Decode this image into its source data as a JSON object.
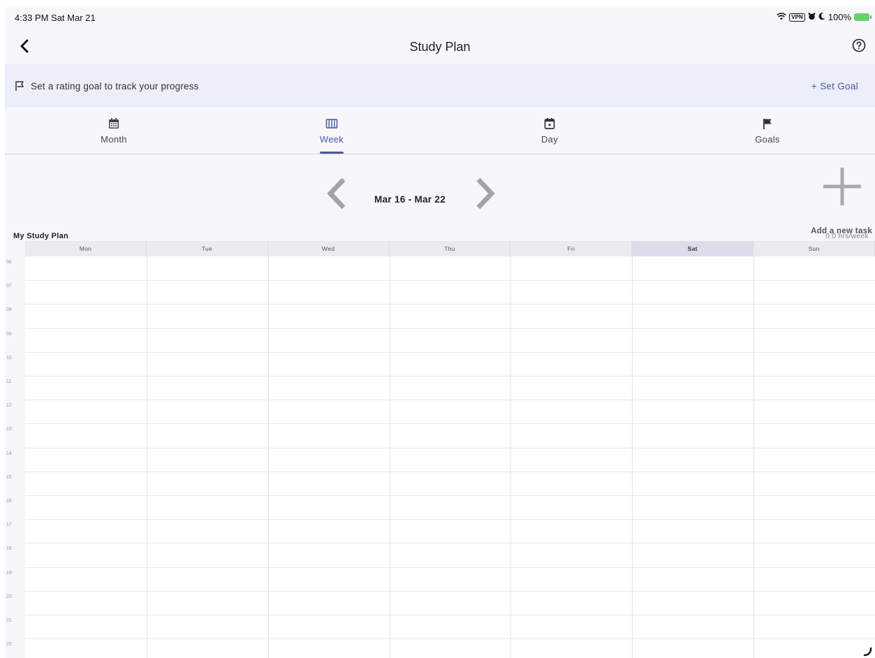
{
  "status_bar": {
    "time": "4:33 PM  Sat Mar 21",
    "vpn": "VPN",
    "battery": "100%"
  },
  "nav": {
    "title": "Study Plan",
    "back_icon": "chevron-left-icon",
    "help_icon": "help-circle-icon"
  },
  "goal_banner": {
    "text": "Set a rating goal to track your progress",
    "action": "+  Set Goal",
    "icon": "flag-outline-icon"
  },
  "tabs": [
    {
      "label": "Month",
      "icon": "calendar-month-icon",
      "active": false
    },
    {
      "label": "Week",
      "icon": "calendar-week-icon",
      "active": true
    },
    {
      "label": "Day",
      "icon": "calendar-day-icon",
      "active": false
    },
    {
      "label": "Goals",
      "icon": "flag-icon",
      "active": false
    }
  ],
  "week_nav": {
    "range": "Mar 16 - Mar 22",
    "add_task_label": "Add a new task"
  },
  "plan": {
    "title": "My Study Plan",
    "hours_per_week": "0.0 hrs/week"
  },
  "calendar": {
    "days": [
      "Mon",
      "Tue",
      "Wed",
      "Thu",
      "Fri",
      "Sat",
      "Sun"
    ],
    "today": "Sat",
    "hours": [
      "06",
      "07",
      "08",
      "09",
      "10",
      "11",
      "12",
      "13",
      "14",
      "15",
      "16",
      "17",
      "18",
      "19",
      "20",
      "21",
      "22"
    ]
  },
  "colors": {
    "accent": "#4b5a9c",
    "banner_bg": "#eceef9",
    "today_header": "#dcdcea"
  }
}
